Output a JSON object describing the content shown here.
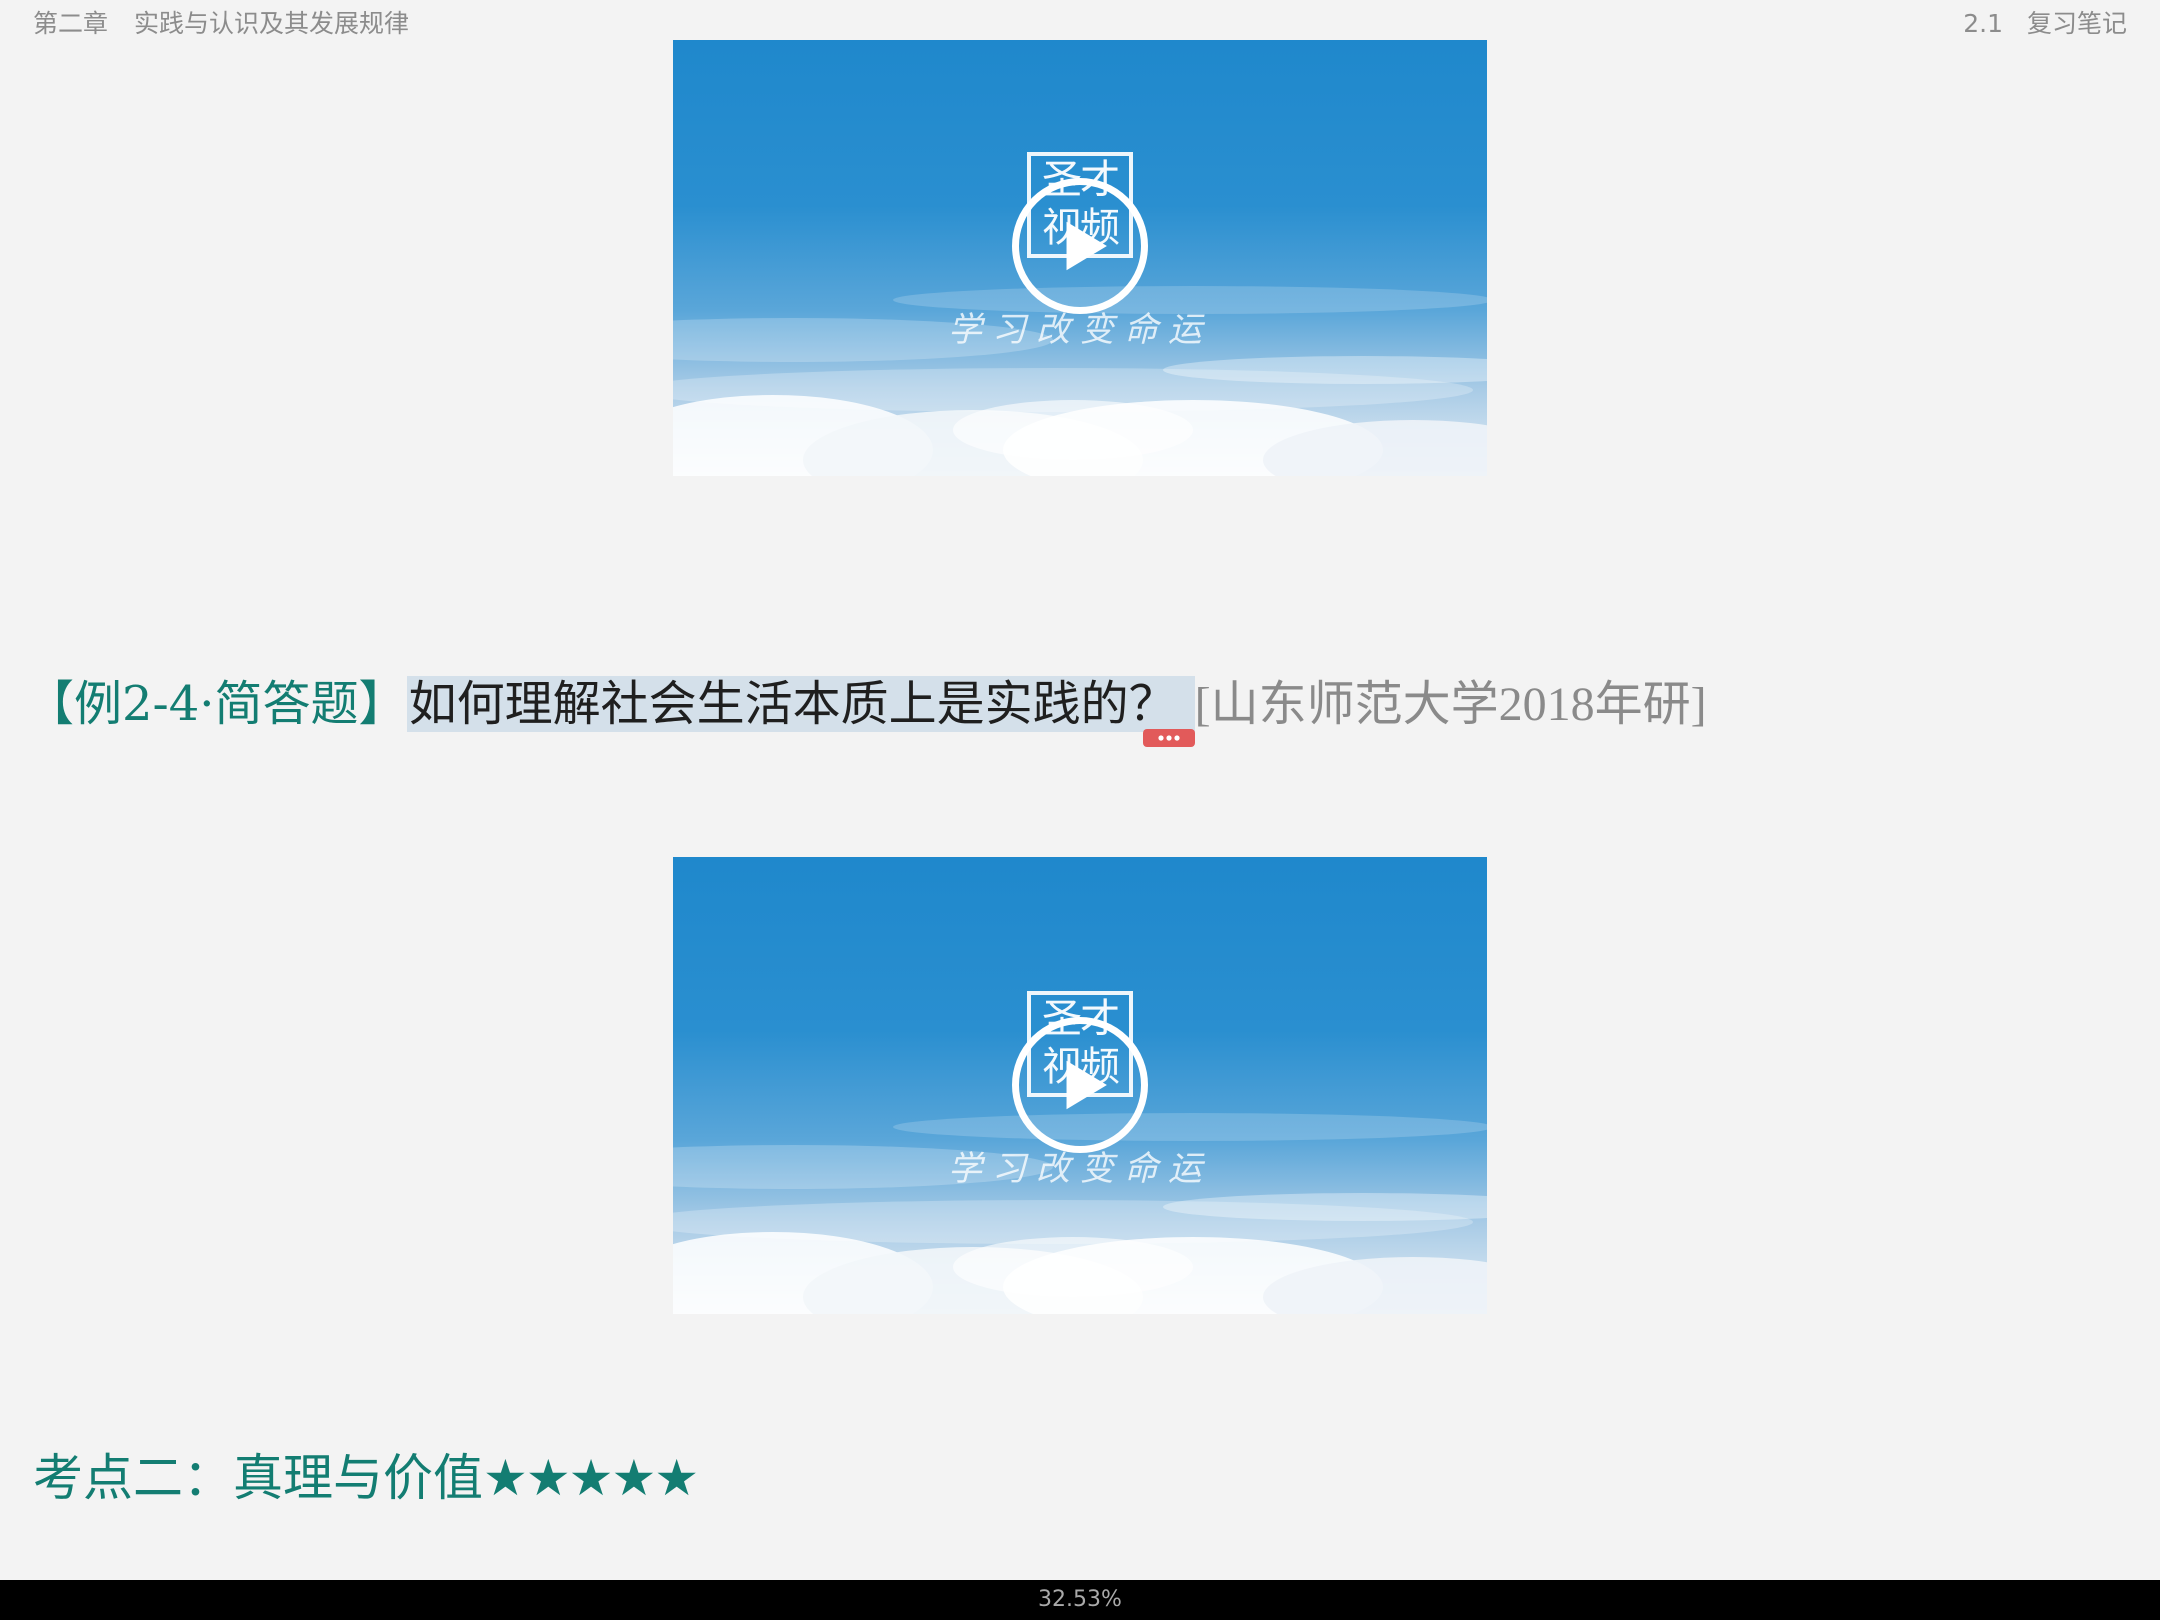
{
  "header": {
    "chapter": "第二章",
    "chapter_title": "实践与认识及其发展规律",
    "section_number": "2.1",
    "section_title": "复习笔记"
  },
  "videos": [
    {
      "logo_line1": "圣才",
      "logo_line2": "视频",
      "slogan": "学习改变命运",
      "icon": "play-icon"
    },
    {
      "logo_line1": "圣才",
      "logo_line2": "视频",
      "slogan": "学习改变命运",
      "icon": "play-icon"
    }
  ],
  "example": {
    "label": "【例2-4·简答题】",
    "question": "如何理解社会生活本质上是实践的？",
    "source": "[山东师范大学2018年研]",
    "more_icon": "more-dots-icon"
  },
  "section": {
    "title": "考点二：真理与价值",
    "stars": "★★★★★",
    "rating": 5
  },
  "footer": {
    "progress": "32.53%"
  },
  "colors": {
    "accent_teal": "#137d72",
    "highlight": "#d4e0ea",
    "more_button": "#e25a5a",
    "background": "#f3f3f3"
  }
}
